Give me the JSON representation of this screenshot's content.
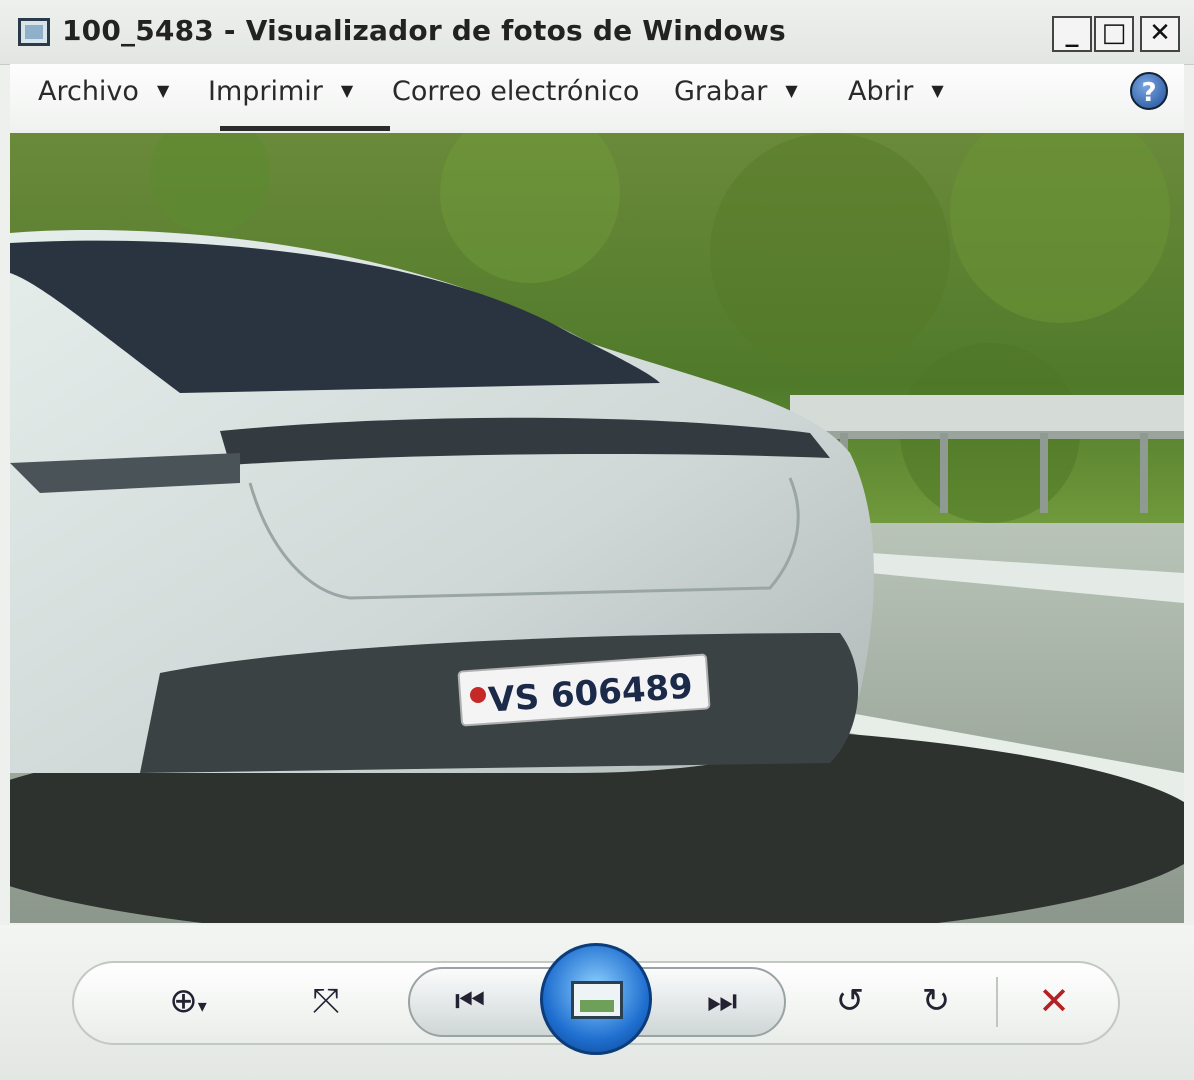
{
  "window": {
    "title": "100_5483 - Visualizador de fotos de Windows",
    "controls": {
      "minimize": "_",
      "maximize": "□",
      "close": "✕"
    }
  },
  "menu": {
    "items": [
      {
        "label": "Archivo",
        "has_dropdown": true
      },
      {
        "label": "Imprimir",
        "has_dropdown": true
      },
      {
        "label": "Correo electrónico",
        "has_dropdown": false
      },
      {
        "label": "Grabar",
        "has_dropdown": true
      },
      {
        "label": "Abrir",
        "has_dropdown": true
      }
    ],
    "help_icon": "?"
  },
  "photo": {
    "description_icon": "car-rear-photo",
    "plate_text": "VS 606489"
  },
  "toolbar": {
    "zoom_icon": "⊕",
    "zoom_caret": "▾",
    "fit_icon": "⤧",
    "previous_icon": "⏮",
    "next_icon": "⏭",
    "rotate_left_icon": "↺",
    "rotate_right_icon": "↻",
    "delete_icon": "✕",
    "colors": {
      "delete": "#b22222",
      "accent": "#1f6fd0"
    }
  }
}
